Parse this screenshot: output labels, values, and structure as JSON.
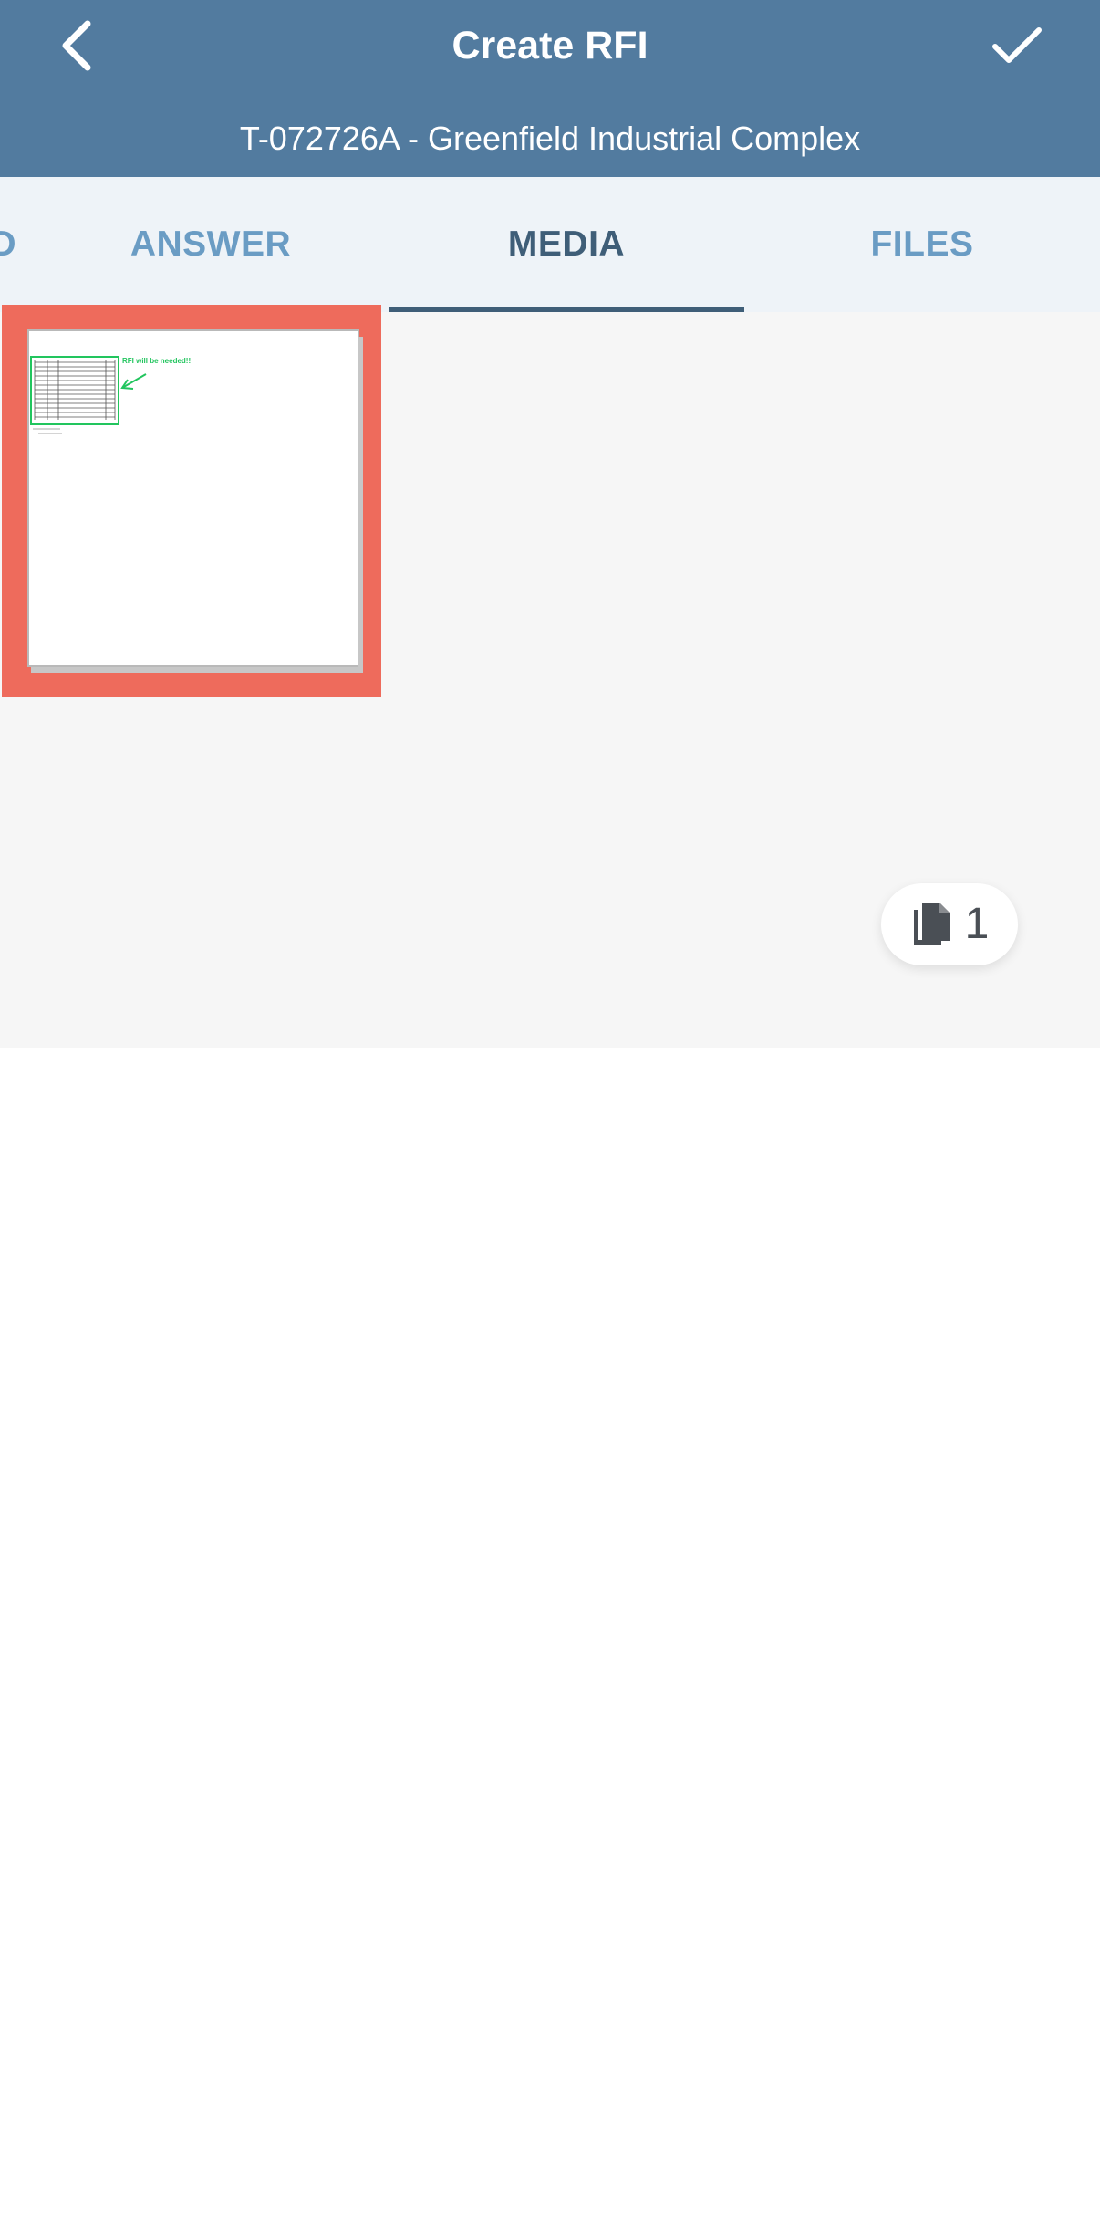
{
  "header": {
    "title": "Create RFI",
    "subtitle": "T-072726A - Greenfield Industrial Complex",
    "background": "#527b9f",
    "back_icon": "chevron-left-icon",
    "done_icon": "checkmark-icon"
  },
  "tabs": {
    "items": [
      {
        "label": "D",
        "active": false
      },
      {
        "label": "ANSWER",
        "active": false
      },
      {
        "label": "MEDIA",
        "active": true
      },
      {
        "label": "FILES",
        "active": false
      }
    ],
    "active_color": "#3f5e78",
    "inactive_color": "#6a9cc4"
  },
  "media": {
    "thumbnail": {
      "selected": true,
      "selection_color": "#ee6b5c",
      "annotation_text": "RFI will be needed!!",
      "annotation_color": "#22c55e"
    },
    "doc_count": {
      "icon": "documents-icon",
      "count": "1"
    }
  }
}
